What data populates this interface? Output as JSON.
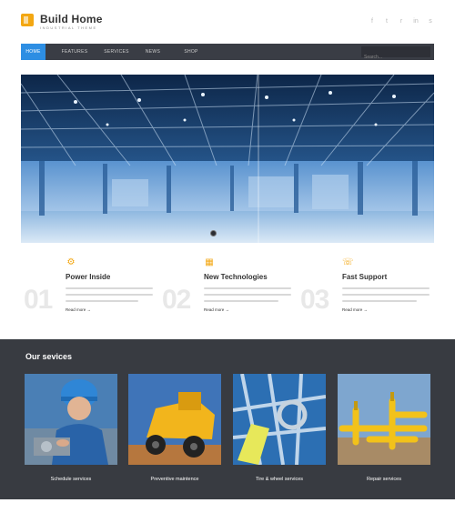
{
  "brand": {
    "title": "Build Home",
    "subtitle": "INDUSTRIAL THEME"
  },
  "social": [
    {
      "icon": "facebook-icon",
      "glyph": "f"
    },
    {
      "icon": "twitter-icon",
      "glyph": "t"
    },
    {
      "icon": "rss-icon",
      "glyph": "r"
    },
    {
      "icon": "linkedin-icon",
      "glyph": "in"
    },
    {
      "icon": "skype-icon",
      "glyph": "s"
    }
  ],
  "nav": {
    "items": [
      {
        "label": "HOME"
      },
      {
        "label": "FEATURES"
      },
      {
        "label": "SERVICES"
      },
      {
        "label": "NEWS"
      },
      {
        "label": "SHOP"
      }
    ],
    "search_placeholder": "Search..."
  },
  "features": [
    {
      "number": "01",
      "title": "Power Inside",
      "more": "Read more →",
      "icon": "gear-icon"
    },
    {
      "number": "02",
      "title": "New Technologies",
      "more": "Read more →",
      "icon": "technology-icon"
    },
    {
      "number": "03",
      "title": "Fast Support",
      "more": "Read more →",
      "icon": "support-icon"
    }
  ],
  "services": {
    "title": "Our sevices",
    "items": [
      {
        "label": "Schedule services"
      },
      {
        "label": "Preventive maintence"
      },
      {
        "label": "Tire & wheel services"
      },
      {
        "label": "Repair services"
      }
    ]
  },
  "colors": {
    "accent": "#2d8ee3",
    "brand": "#f3a712",
    "nav_bg": "#3a3d45",
    "services_bg": "#383b41"
  }
}
